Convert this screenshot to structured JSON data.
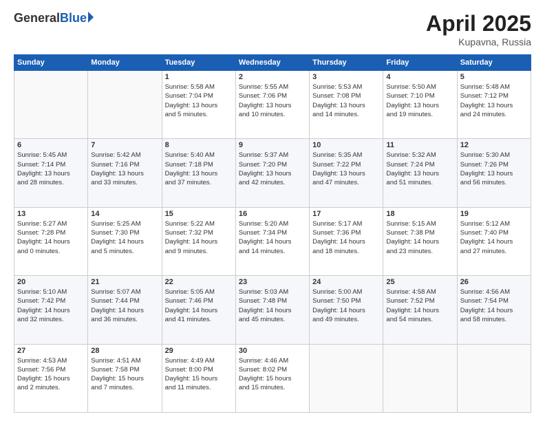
{
  "header": {
    "logo_general": "General",
    "logo_blue": "Blue",
    "month_title": "April 2025",
    "location": "Kupavna, Russia"
  },
  "weekdays": [
    "Sunday",
    "Monday",
    "Tuesday",
    "Wednesday",
    "Thursday",
    "Friday",
    "Saturday"
  ],
  "weeks": [
    [
      {
        "day": "",
        "lines": []
      },
      {
        "day": "",
        "lines": []
      },
      {
        "day": "1",
        "lines": [
          "Sunrise: 5:58 AM",
          "Sunset: 7:04 PM",
          "Daylight: 13 hours",
          "and 5 minutes."
        ]
      },
      {
        "day": "2",
        "lines": [
          "Sunrise: 5:55 AM",
          "Sunset: 7:06 PM",
          "Daylight: 13 hours",
          "and 10 minutes."
        ]
      },
      {
        "day": "3",
        "lines": [
          "Sunrise: 5:53 AM",
          "Sunset: 7:08 PM",
          "Daylight: 13 hours",
          "and 14 minutes."
        ]
      },
      {
        "day": "4",
        "lines": [
          "Sunrise: 5:50 AM",
          "Sunset: 7:10 PM",
          "Daylight: 13 hours",
          "and 19 minutes."
        ]
      },
      {
        "day": "5",
        "lines": [
          "Sunrise: 5:48 AM",
          "Sunset: 7:12 PM",
          "Daylight: 13 hours",
          "and 24 minutes."
        ]
      }
    ],
    [
      {
        "day": "6",
        "lines": [
          "Sunrise: 5:45 AM",
          "Sunset: 7:14 PM",
          "Daylight: 13 hours",
          "and 28 minutes."
        ]
      },
      {
        "day": "7",
        "lines": [
          "Sunrise: 5:42 AM",
          "Sunset: 7:16 PM",
          "Daylight: 13 hours",
          "and 33 minutes."
        ]
      },
      {
        "day": "8",
        "lines": [
          "Sunrise: 5:40 AM",
          "Sunset: 7:18 PM",
          "Daylight: 13 hours",
          "and 37 minutes."
        ]
      },
      {
        "day": "9",
        "lines": [
          "Sunrise: 5:37 AM",
          "Sunset: 7:20 PM",
          "Daylight: 13 hours",
          "and 42 minutes."
        ]
      },
      {
        "day": "10",
        "lines": [
          "Sunrise: 5:35 AM",
          "Sunset: 7:22 PM",
          "Daylight: 13 hours",
          "and 47 minutes."
        ]
      },
      {
        "day": "11",
        "lines": [
          "Sunrise: 5:32 AM",
          "Sunset: 7:24 PM",
          "Daylight: 13 hours",
          "and 51 minutes."
        ]
      },
      {
        "day": "12",
        "lines": [
          "Sunrise: 5:30 AM",
          "Sunset: 7:26 PM",
          "Daylight: 13 hours",
          "and 56 minutes."
        ]
      }
    ],
    [
      {
        "day": "13",
        "lines": [
          "Sunrise: 5:27 AM",
          "Sunset: 7:28 PM",
          "Daylight: 14 hours",
          "and 0 minutes."
        ]
      },
      {
        "day": "14",
        "lines": [
          "Sunrise: 5:25 AM",
          "Sunset: 7:30 PM",
          "Daylight: 14 hours",
          "and 5 minutes."
        ]
      },
      {
        "day": "15",
        "lines": [
          "Sunrise: 5:22 AM",
          "Sunset: 7:32 PM",
          "Daylight: 14 hours",
          "and 9 minutes."
        ]
      },
      {
        "day": "16",
        "lines": [
          "Sunrise: 5:20 AM",
          "Sunset: 7:34 PM",
          "Daylight: 14 hours",
          "and 14 minutes."
        ]
      },
      {
        "day": "17",
        "lines": [
          "Sunrise: 5:17 AM",
          "Sunset: 7:36 PM",
          "Daylight: 14 hours",
          "and 18 minutes."
        ]
      },
      {
        "day": "18",
        "lines": [
          "Sunrise: 5:15 AM",
          "Sunset: 7:38 PM",
          "Daylight: 14 hours",
          "and 23 minutes."
        ]
      },
      {
        "day": "19",
        "lines": [
          "Sunrise: 5:12 AM",
          "Sunset: 7:40 PM",
          "Daylight: 14 hours",
          "and 27 minutes."
        ]
      }
    ],
    [
      {
        "day": "20",
        "lines": [
          "Sunrise: 5:10 AM",
          "Sunset: 7:42 PM",
          "Daylight: 14 hours",
          "and 32 minutes."
        ]
      },
      {
        "day": "21",
        "lines": [
          "Sunrise: 5:07 AM",
          "Sunset: 7:44 PM",
          "Daylight: 14 hours",
          "and 36 minutes."
        ]
      },
      {
        "day": "22",
        "lines": [
          "Sunrise: 5:05 AM",
          "Sunset: 7:46 PM",
          "Daylight: 14 hours",
          "and 41 minutes."
        ]
      },
      {
        "day": "23",
        "lines": [
          "Sunrise: 5:03 AM",
          "Sunset: 7:48 PM",
          "Daylight: 14 hours",
          "and 45 minutes."
        ]
      },
      {
        "day": "24",
        "lines": [
          "Sunrise: 5:00 AM",
          "Sunset: 7:50 PM",
          "Daylight: 14 hours",
          "and 49 minutes."
        ]
      },
      {
        "day": "25",
        "lines": [
          "Sunrise: 4:58 AM",
          "Sunset: 7:52 PM",
          "Daylight: 14 hours",
          "and 54 minutes."
        ]
      },
      {
        "day": "26",
        "lines": [
          "Sunrise: 4:56 AM",
          "Sunset: 7:54 PM",
          "Daylight: 14 hours",
          "and 58 minutes."
        ]
      }
    ],
    [
      {
        "day": "27",
        "lines": [
          "Sunrise: 4:53 AM",
          "Sunset: 7:56 PM",
          "Daylight: 15 hours",
          "and 2 minutes."
        ]
      },
      {
        "day": "28",
        "lines": [
          "Sunrise: 4:51 AM",
          "Sunset: 7:58 PM",
          "Daylight: 15 hours",
          "and 7 minutes."
        ]
      },
      {
        "day": "29",
        "lines": [
          "Sunrise: 4:49 AM",
          "Sunset: 8:00 PM",
          "Daylight: 15 hours",
          "and 11 minutes."
        ]
      },
      {
        "day": "30",
        "lines": [
          "Sunrise: 4:46 AM",
          "Sunset: 8:02 PM",
          "Daylight: 15 hours",
          "and 15 minutes."
        ]
      },
      {
        "day": "",
        "lines": []
      },
      {
        "day": "",
        "lines": []
      },
      {
        "day": "",
        "lines": []
      }
    ]
  ]
}
